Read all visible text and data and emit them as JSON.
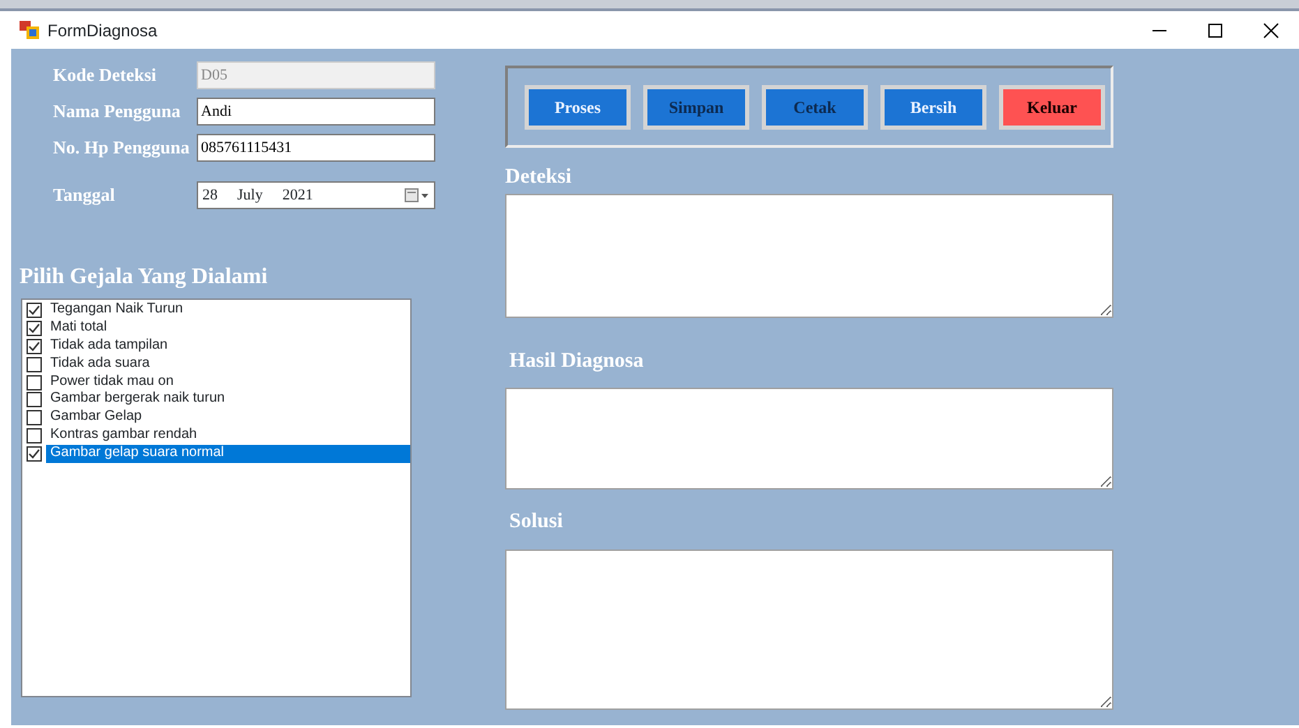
{
  "window": {
    "title": "FormDiagnosa"
  },
  "fields": [
    {
      "label": "Kode Deteksi",
      "value": "D05",
      "disabled": true
    },
    {
      "label": "Nama Pengguna",
      "value": "Andi",
      "disabled": false
    },
    {
      "label": "No. Hp Pengguna",
      "value": "085761115431",
      "disabled": false
    }
  ],
  "date": {
    "label": "Tanggal",
    "day": "28",
    "month": "July",
    "year": "2021"
  },
  "symptoms": {
    "title": "Pilih Gejala Yang Dialami",
    "items": [
      {
        "label": "Tegangan Naik Turun",
        "checked": true,
        "selected": false
      },
      {
        "label": "Mati total",
        "checked": true,
        "selected": false
      },
      {
        "label": "Tidak ada tampilan",
        "checked": true,
        "selected": false
      },
      {
        "label": "Tidak ada suara",
        "checked": false,
        "selected": false
      },
      {
        "label": "Power tidak mau on",
        "checked": false,
        "selected": false
      },
      {
        "label": "Gambar bergerak naik turun",
        "checked": false,
        "selected": false
      },
      {
        "label": "Gambar Gelap",
        "checked": false,
        "selected": false
      },
      {
        "label": "Kontras gambar rendah",
        "checked": false,
        "selected": false
      },
      {
        "label": "Gambar gelap suara normal",
        "checked": true,
        "selected": true
      }
    ]
  },
  "buttons": [
    {
      "label": "Proses",
      "kind": "light"
    },
    {
      "label": "Simpan",
      "kind": "dark"
    },
    {
      "label": "Cetak",
      "kind": "dark"
    },
    {
      "label": "Bersih",
      "kind": "light"
    },
    {
      "label": "Keluar",
      "kind": "exit"
    }
  ],
  "outputs": [
    {
      "label": "Deteksi"
    },
    {
      "label": "Hasil Diagnosa"
    },
    {
      "label": "Solusi"
    }
  ]
}
